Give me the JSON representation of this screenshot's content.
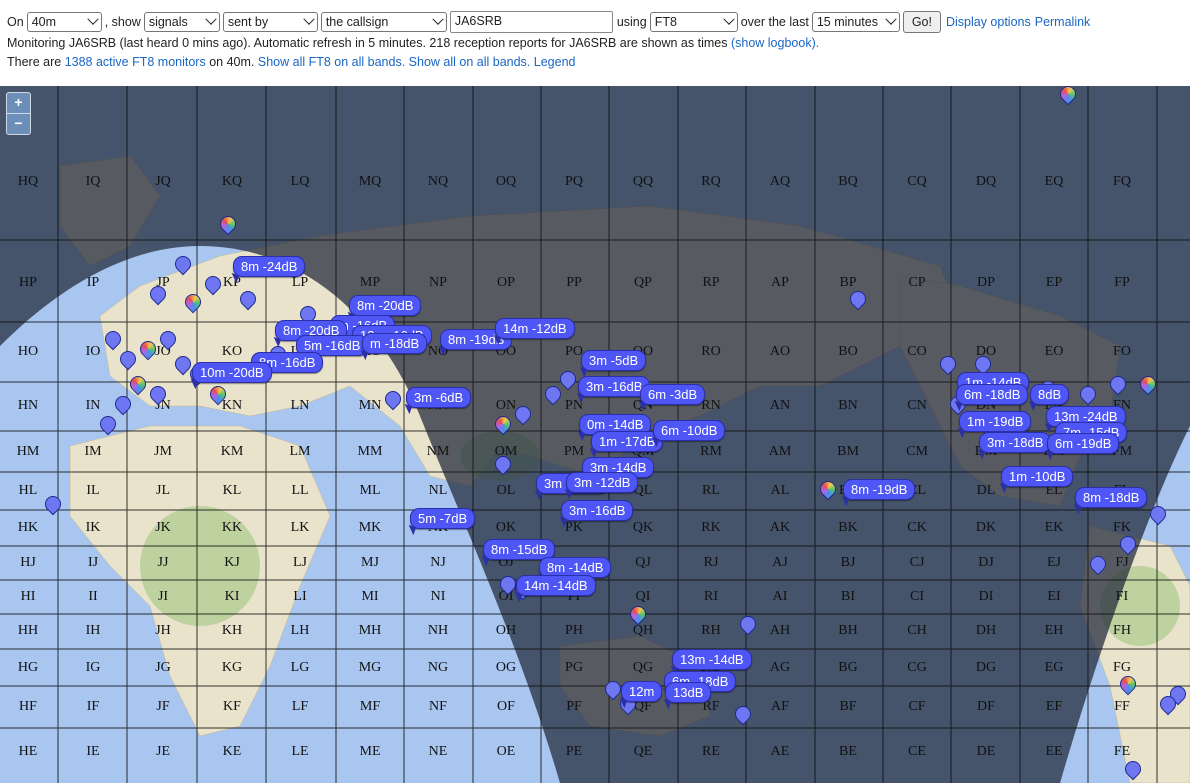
{
  "controls": {
    "on_label": "On",
    "band": "40m",
    "show_label": ", show",
    "show": "signals",
    "direction": "sent by",
    "target": "the callsign",
    "callsign": "JA6SRB",
    "using_label": "using",
    "mode": "FT8",
    "over_label": "over the last",
    "period": "15 minutes",
    "go": "Go!",
    "display_options": "Display options",
    "permalink": "Permalink"
  },
  "status": {
    "line1_text": "Monitoring JA6SRB (last heard 0 mins ago). Automatic refresh in 5 minutes. 218 reception reports for JA6SRB are shown as times",
    "show_logbook": "(show logbook).",
    "line2_prefix": "There are",
    "active_monitors": "1388 active FT8 monitors",
    "line2_mid": "on 40m.",
    "show_all_ft8": "Show all FT8 on all bands.",
    "show_all": "Show all on all bands.",
    "legend": "Legend"
  },
  "map": {
    "zoom_in": "+",
    "zoom_out": "−",
    "columns": [
      "HQ",
      "IQ",
      "JQ",
      "KQ",
      "LQ",
      "MQ",
      "NQ",
      "OQ",
      "PQ",
      "QQ",
      "RQ",
      "AQ",
      "BQ",
      "CQ",
      "DQ",
      "EQ",
      "FQ"
    ],
    "col_letters": [
      "H",
      "I",
      "J",
      "K",
      "L",
      "M",
      "N",
      "O",
      "P",
      "Q",
      "R",
      "A",
      "B",
      "C",
      "D",
      "E",
      "F"
    ],
    "row_letters": [
      "Q",
      "P",
      "O",
      "N",
      "M",
      "L",
      "K",
      "J",
      "I",
      "H",
      "G",
      "F",
      "E"
    ],
    "reports": [
      "8m -24dB",
      "8m -20dB",
      "m -16dB",
      "8m -20dB",
      "12m -16dB",
      "5m -16dB",
      "m -18dB",
      "8m -19dB",
      "14m -12dB",
      "8m -16dB",
      "10m -20dB",
      "3m -6dB",
      "3m -5dB",
      "3m -16dB",
      "6m -3dB",
      "0m -14dB",
      "1m -17dB",
      "6m -10dB",
      "3m -12dB",
      "3m -14dB",
      "3m -12dB",
      "3m -16dB",
      "8m -15dB",
      "8m -14dB",
      "14m -14dB",
      "5m -7dB",
      "8m -19dB",
      "1m -14dB",
      "6m -18dB",
      "8dB",
      "1m -19dB",
      "13m -24dB",
      "7m -15dB",
      "3m -18dB",
      "6m -19dB",
      "1m -10dB",
      "8m -18dB",
      "13m -14dB",
      "6m -18dB",
      "12m",
      "13dB"
    ]
  },
  "colors": {
    "link": "#1a66c4",
    "report_bg": "#4e56f5",
    "ocean": "#a9c6f0",
    "night": "#1e2738"
  }
}
